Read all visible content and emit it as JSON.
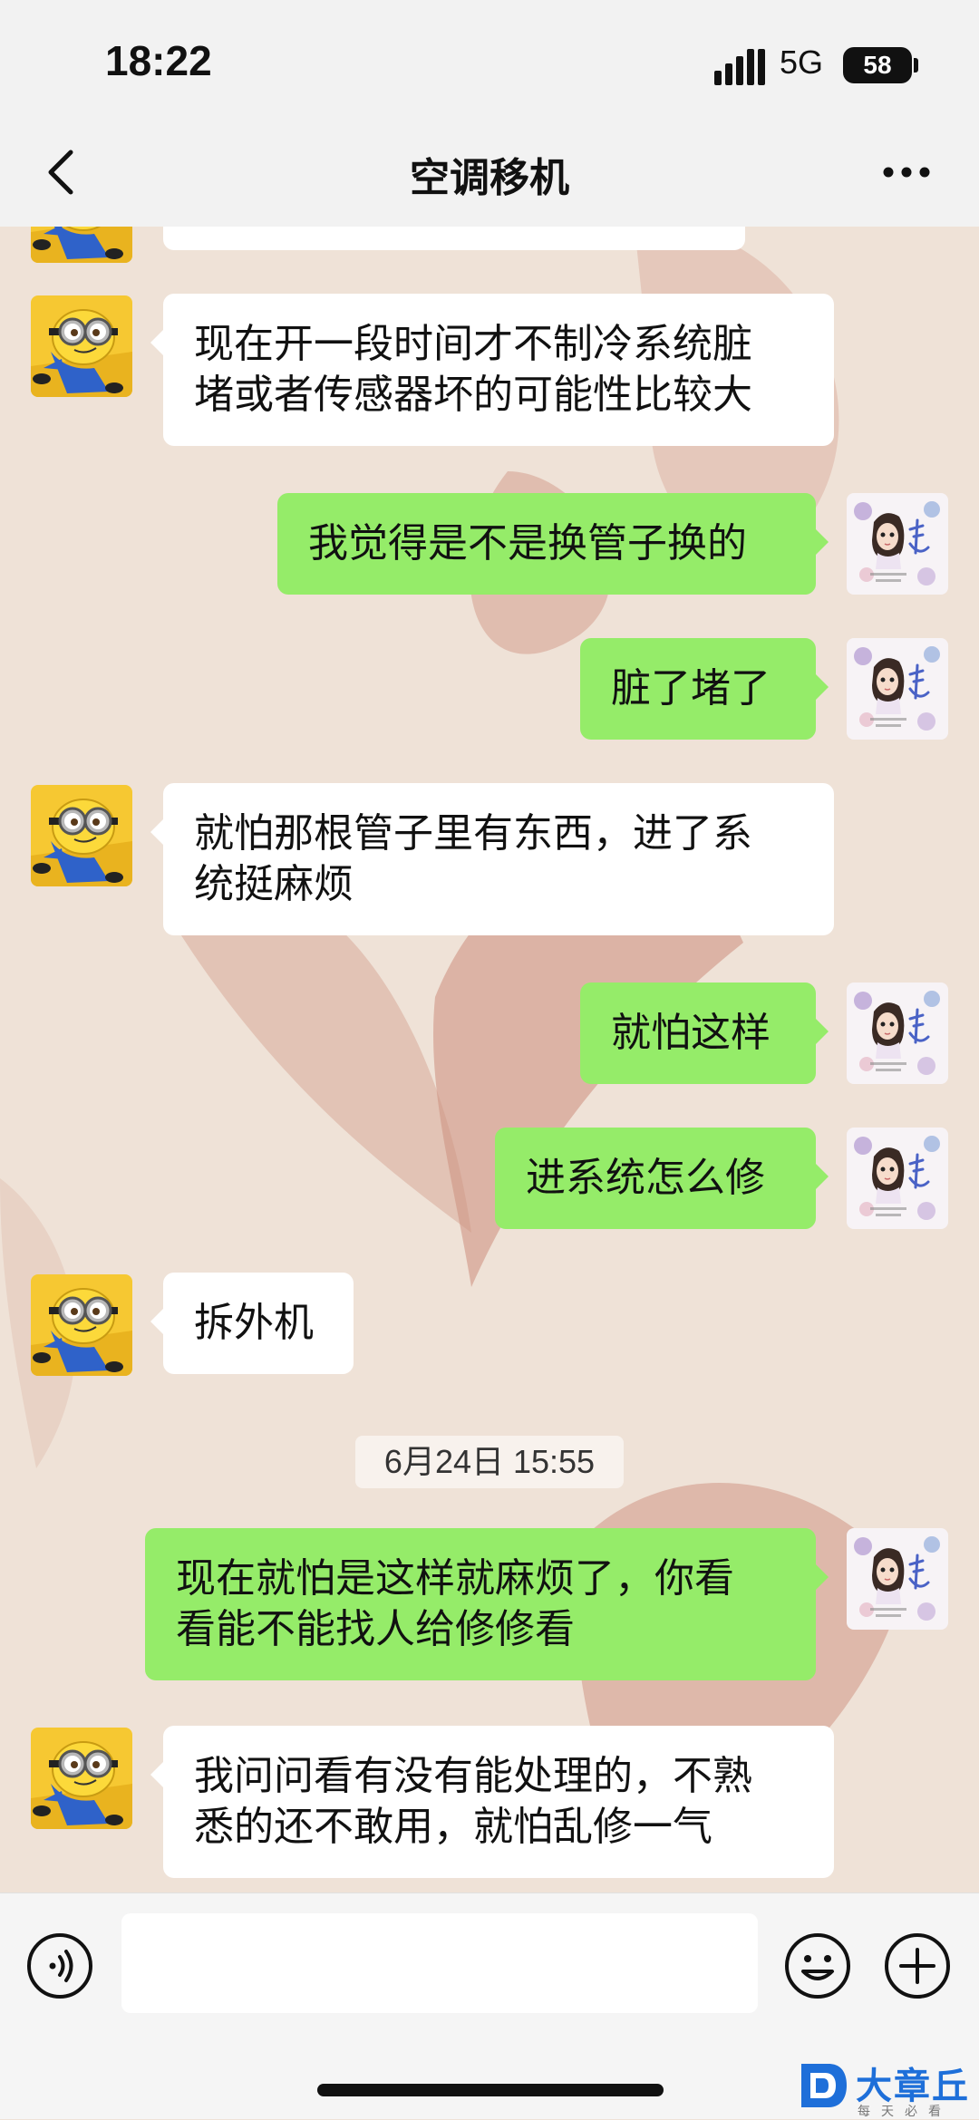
{
  "status_bar": {
    "time": "18:22",
    "network": "5G",
    "battery": "58"
  },
  "nav": {
    "title": "空调移机",
    "back_icon": "chevron-left-icon",
    "more_icon": "more-dots-icon"
  },
  "messages": [
    {
      "side": "left",
      "lines": [
        "现在开一段时间才不制冷系统脏",
        "堵或者传感器坏的可能性比较大"
      ]
    },
    {
      "side": "right",
      "lines": [
        "我觉得是不是换管子换的"
      ]
    },
    {
      "side": "right",
      "lines": [
        "脏了堵了"
      ]
    },
    {
      "side": "left",
      "lines": [
        "就怕那根管子里有东西，进了系",
        "统挺麻烦"
      ]
    },
    {
      "side": "right",
      "lines": [
        "就怕这样"
      ]
    },
    {
      "side": "right",
      "lines": [
        "进系统怎么修"
      ]
    },
    {
      "side": "left",
      "lines": [
        "拆外机"
      ]
    },
    {
      "side": "right",
      "lines": [
        "现在就怕是这样就麻烦了，你看",
        "看能不能找人给修修看"
      ]
    },
    {
      "side": "left",
      "lines": [
        "我问问看有没有能处理的，不熟",
        "悉的还不敢用，就怕乱修一气"
      ]
    }
  ],
  "timestamp": "6月24日 15:55",
  "input_bar": {
    "voice_icon": "voice-icon",
    "emoji_icon": "emoji-icon",
    "plus_icon": "plus-icon",
    "input_value": ""
  },
  "watermark": {
    "title": "大章丘",
    "subtitle": "每天必看"
  },
  "colors": {
    "incoming_bubble": "#FFFFFF",
    "outgoing_bubble": "#95EC69",
    "bar_background": "#F2F2F2"
  }
}
